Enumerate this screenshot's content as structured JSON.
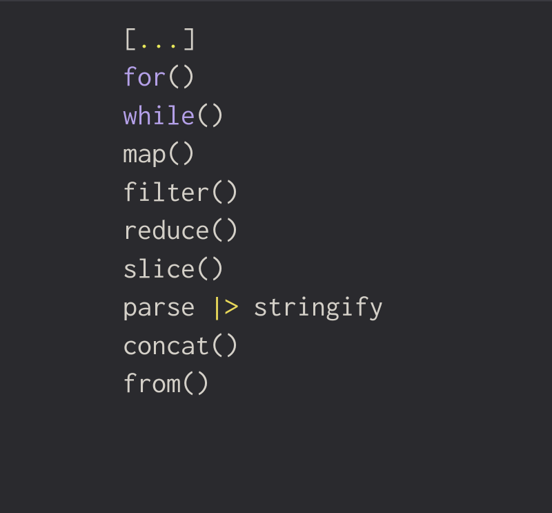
{
  "code": {
    "lines": [
      {
        "segments": [
          {
            "text": "[",
            "cls": "c-default"
          },
          {
            "text": "...",
            "cls": "c-yellow"
          },
          {
            "text": "]",
            "cls": "c-default"
          }
        ]
      },
      {
        "segments": [
          {
            "text": "for",
            "cls": "c-keyword"
          },
          {
            "text": "()",
            "cls": "c-default"
          }
        ]
      },
      {
        "segments": [
          {
            "text": "while",
            "cls": "c-keyword"
          },
          {
            "text": "()",
            "cls": "c-default"
          }
        ]
      },
      {
        "segments": [
          {
            "text": "map()",
            "cls": "c-default"
          }
        ]
      },
      {
        "segments": [
          {
            "text": "filter()",
            "cls": "c-default"
          }
        ]
      },
      {
        "segments": [
          {
            "text": "reduce()",
            "cls": "c-default"
          }
        ]
      },
      {
        "segments": [
          {
            "text": "slice()",
            "cls": "c-default"
          }
        ]
      },
      {
        "segments": [
          {
            "text": "parse ",
            "cls": "c-default"
          },
          {
            "text": "|>",
            "cls": "c-pipe"
          },
          {
            "text": " stringify",
            "cls": "c-default"
          }
        ]
      },
      {
        "segments": [
          {
            "text": "concat()",
            "cls": "c-default"
          }
        ]
      },
      {
        "segments": [
          {
            "text": "from()",
            "cls": "c-default"
          }
        ]
      }
    ]
  },
  "colors": {
    "background": "#2a2a2e",
    "default": "#d4d0c8",
    "keyword": "#b4a0e8",
    "yellow": "#e8e85a",
    "pipe": "#e8d85a"
  }
}
